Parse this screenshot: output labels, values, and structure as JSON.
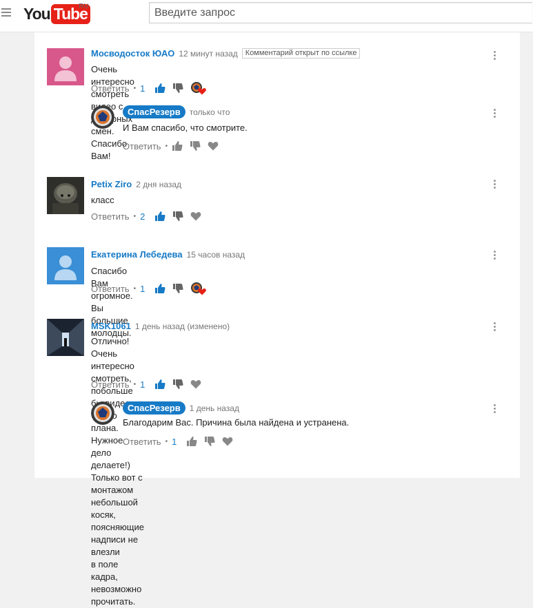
{
  "header": {
    "logo_you": "You",
    "logo_tube": "Tube",
    "logo_region": "RU",
    "search_placeholder": "Введите запрос"
  },
  "comments": [
    {
      "author": "Мосводосток ЮАО",
      "time": "12 минут назад",
      "badge": "Комментарий открыт по ссылке",
      "text": "Очень интересно смотреть видео с дежурных смен. Спасибо Вам!",
      "reply_label": "Ответить",
      "likes": "1",
      "reply": {
        "author": "СпасРезерв",
        "time": "только что",
        "text": "И Вам спасибо, что смотрите.",
        "reply_label": "Ответить"
      }
    },
    {
      "author": "Petix Ziro",
      "time": "2 дня назад",
      "text": "класс",
      "reply_label": "Ответить",
      "likes": "2"
    },
    {
      "author": "Екатерина Лебедева",
      "time": "15 часов назад",
      "text": "Спасибо Вам огромное. Вы большие молодцы.",
      "reply_label": "Ответить",
      "likes": "1"
    },
    {
      "author": "MSK1061",
      "time": "1 день назад (изменено)",
      "text_lines": [
        "Отлично! Очень интересно смотреть, побольше бы видео такого плана. Нужное дело",
        "делаете!) Только вот с монтажом небольшой косяк, поясняющие надписи не влезли",
        "в поле кадра, невозможно прочитать."
      ],
      "reply_label": "Ответить",
      "likes": "1",
      "reply": {
        "author": "СпасРезерв",
        "time": "1 день назад",
        "text": "Благодарим Вас. Причина была найдена и устранена.",
        "reply_label": "Ответить",
        "likes": "1"
      }
    }
  ],
  "colors": {
    "accent": "#167ac6",
    "brand_red": "#e62117",
    "heart_red": "#e62117"
  }
}
